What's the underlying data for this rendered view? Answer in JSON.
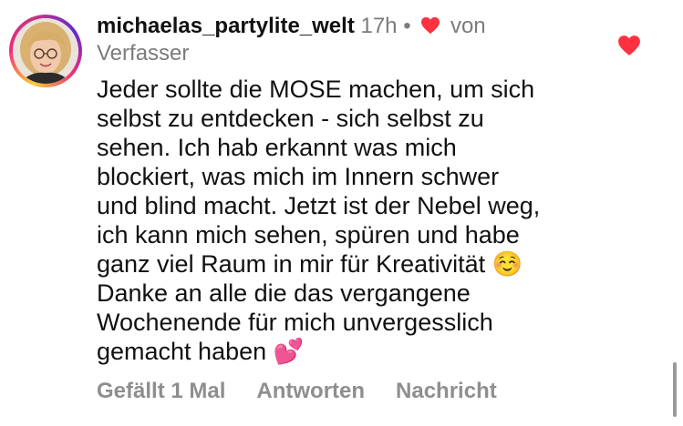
{
  "comment": {
    "username": "michaelas_partylite_welt",
    "time": "17h",
    "separator": "•",
    "liked_by_author_label": "von",
    "liked_by_author_label_2": "Verfasser",
    "text": "Jeder sollte die MOSE machen, um sich\nselbst zu entdecken - sich selbst zu\nsehen. Ich hab erkannt was mich\nblockiert, was mich im Innern schwer\nund blind macht. Jetzt ist der Nebel weg,\nich kann mich sehen, spüren und habe\nganz viel Raum in mir für Kreativität ☺️\nDanke an alle die das vergangene\nWochenende für mich unvergesslich\ngemacht haben 💕",
    "liked": true
  },
  "actions": {
    "likes_label": "Gefällt 1 Mal",
    "reply_label": "Antworten",
    "message_label": "Nachricht"
  },
  "icons": {
    "like_heart": "heart-filled-icon",
    "author_heart": "heart-filled-icon"
  },
  "colors": {
    "heart": "#ff3040",
    "meta_text": "#7b7b7b",
    "action_text": "#8e8e8e"
  }
}
